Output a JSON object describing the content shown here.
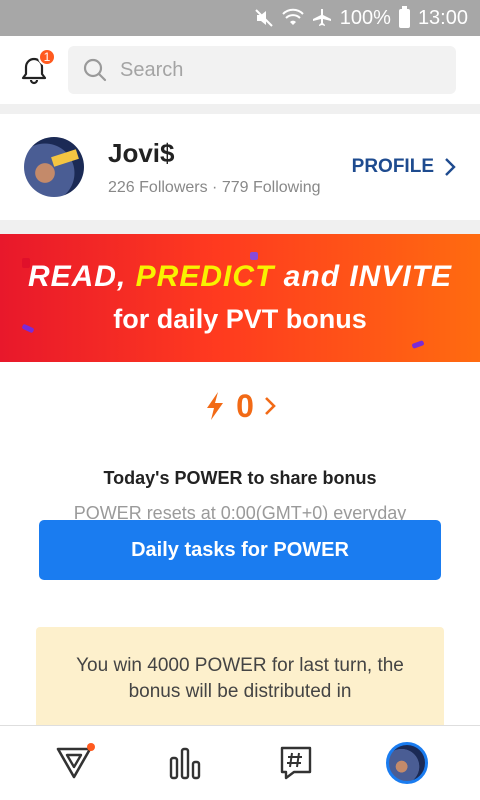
{
  "status_bar": {
    "battery": "100%",
    "time": "13:00"
  },
  "header": {
    "notification_count": "1",
    "search_placeholder": "Search"
  },
  "profile": {
    "name": "Jovi$",
    "stats": "226 Followers · 779 Following",
    "link_label": "PROFILE"
  },
  "banner": {
    "line1_pre": "READ, ",
    "line1_highlight": "PREDICT",
    "line1_post": " and INVITE",
    "line2": "for daily PVT bonus",
    "colors": {
      "start": "#e8182b",
      "end": "#ff6b10",
      "highlight": "#f8f200"
    }
  },
  "power": {
    "value": "0",
    "title": "Today's POWER to share bonus",
    "subtitle": "POWER resets at 0:00(GMT+0) everyday",
    "button_label": "Daily tasks for POWER",
    "win_message": "You win 4000 POWER for last turn, the bonus will be distributed in",
    "accent_color": "#f26a16",
    "button_color": "#1a7cf0"
  },
  "bottom_nav": {
    "items": [
      {
        "icon": "home-logo-icon",
        "has_dot": true
      },
      {
        "icon": "chart-icon"
      },
      {
        "icon": "hashtag-chat-icon"
      },
      {
        "icon": "avatar-profile-icon",
        "active": true
      }
    ]
  }
}
